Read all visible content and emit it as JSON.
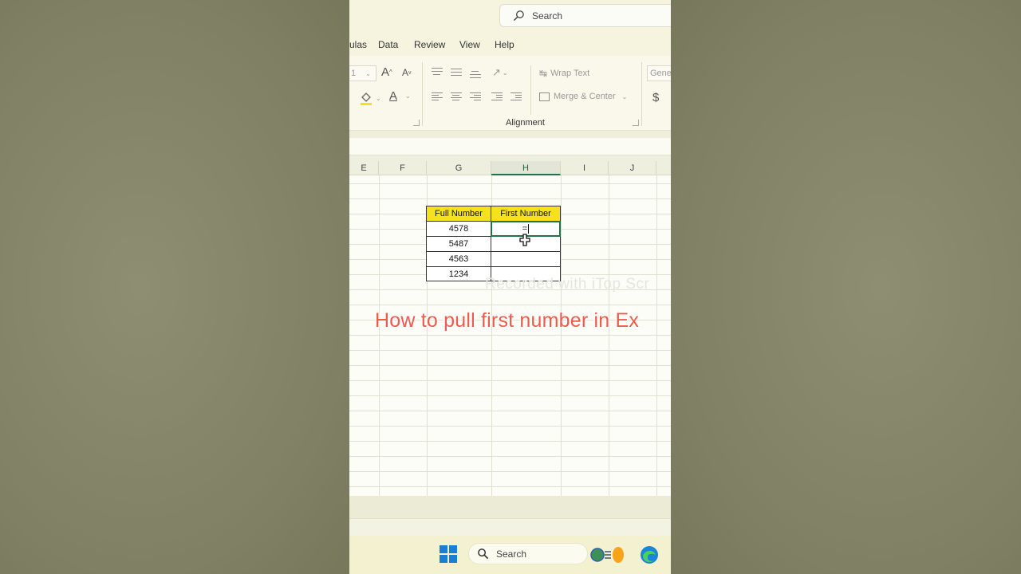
{
  "titlebar": {
    "search_label": "Search"
  },
  "ribbon_tabs": [
    "ulas",
    "Data",
    "Review",
    "View",
    "Help"
  ],
  "ribbon": {
    "font_size_value": "1",
    "grow_font": "A",
    "shrink_font": "A",
    "font_color_letter": "A",
    "wrap_text_label": "Wrap Text",
    "merge_center_label": "Merge & Center",
    "alignment_group_label": "Alignment",
    "number_format_value": "Gene",
    "currency_symbol": "$"
  },
  "columns": [
    "E",
    "F",
    "G",
    "H",
    "I",
    "J"
  ],
  "selected_column": "H",
  "table": {
    "headers": [
      "Full Number",
      "First Number"
    ],
    "rows": [
      {
        "full": "4578",
        "first": "="
      },
      {
        "full": "5487",
        "first": ""
      },
      {
        "full": "4563",
        "first": ""
      },
      {
        "full": "1234",
        "first": ""
      }
    ]
  },
  "watermark": "Recorded with iTop Scr",
  "overlay_title": "How to pull first number in Ex",
  "taskbar": {
    "search_label": "Search"
  },
  "colors": {
    "header_fill": "#f4e21e",
    "active_cell_border": "#217346",
    "overlay_title": "#f05a4a",
    "windows_blue": "#1a7fd4"
  }
}
